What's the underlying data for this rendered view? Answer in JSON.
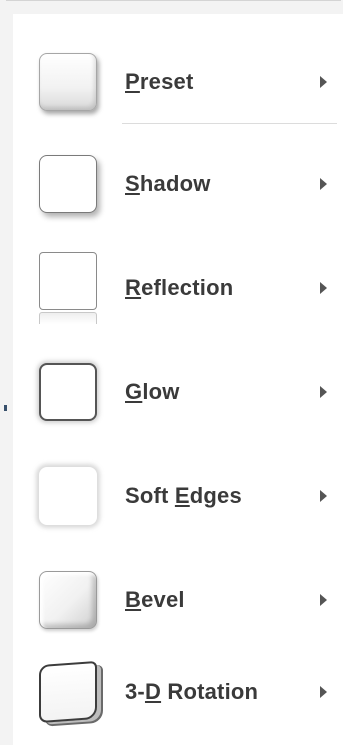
{
  "menu": {
    "items": [
      {
        "prefix": "",
        "accel": "P",
        "suffix": "reset",
        "icon": "preset-effect-icon"
      },
      {
        "prefix": "",
        "accel": "S",
        "suffix": "hadow",
        "icon": "shadow-effect-icon"
      },
      {
        "prefix": "",
        "accel": "R",
        "suffix": "eflection",
        "icon": "reflection-effect-icon"
      },
      {
        "prefix": "",
        "accel": "G",
        "suffix": "low",
        "icon": "glow-effect-icon"
      },
      {
        "prefix": "Soft ",
        "accel": "E",
        "suffix": "dges",
        "icon": "soft-edges-effect-icon"
      },
      {
        "prefix": "",
        "accel": "B",
        "suffix": "evel",
        "icon": "bevel-effect-icon"
      },
      {
        "prefix": "3-",
        "accel": "D",
        "suffix": " Rotation",
        "icon": "3d-rotation-effect-icon"
      }
    ],
    "submenu_icon": "chevron-right-icon"
  },
  "colors": {
    "text": "#3a3a3a",
    "arrow": "#555555",
    "background": "#ffffff",
    "chrome": "#f3f3f3"
  }
}
